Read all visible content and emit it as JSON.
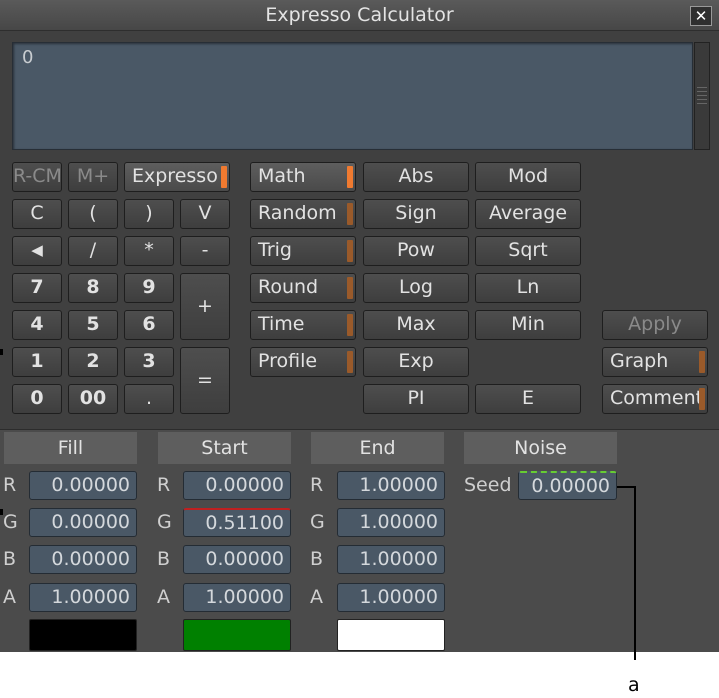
{
  "window": {
    "title": "Expresso Calculator",
    "close_glyph": "✕"
  },
  "display": {
    "value": "0"
  },
  "memory": {
    "rcm": "R-CM",
    "mplus": "M+",
    "expresso": "Expresso"
  },
  "keypad": {
    "c": "C",
    "lparen": "(",
    "rparen": ")",
    "v": "V",
    "back": "◀",
    "div": "/",
    "mul": "*",
    "minus": "-",
    "n7": "7",
    "n8": "8",
    "n9": "9",
    "plus": "+",
    "n4": "4",
    "n5": "5",
    "n6": "6",
    "n1": "1",
    "n2": "2",
    "n3": "3",
    "eq": "=",
    "n0": "0",
    "n00": "00",
    "dot": "."
  },
  "categories": {
    "math": "Math",
    "random": "Random",
    "trig": "Trig",
    "round": "Round",
    "time": "Time",
    "profile": "Profile"
  },
  "functions": {
    "abs": "Abs",
    "mod": "Mod",
    "sign": "Sign",
    "average": "Average",
    "pow": "Pow",
    "sqrt": "Sqrt",
    "log": "Log",
    "ln": "Ln",
    "max": "Max",
    "min": "Min",
    "exp": "Exp",
    "pi": "PI",
    "e": "E"
  },
  "actions": {
    "apply": "Apply",
    "graph": "Graph",
    "comment": "Comment"
  },
  "fill": {
    "header": "Fill",
    "r": "R",
    "g": "G",
    "b": "B",
    "a": "A",
    "r_val": "0.00000",
    "g_val": "0.00000",
    "b_val": "0.00000",
    "a_val": "1.00000",
    "swatch_color": "#000000"
  },
  "start": {
    "header": "Start",
    "r": "R",
    "g": "G",
    "b": "B",
    "a": "A",
    "r_val": "0.00000",
    "g_val": "0.51100",
    "b_val": "0.00000",
    "a_val": "1.00000",
    "swatch_color": "#008000"
  },
  "end": {
    "header": "End",
    "r": "R",
    "g": "G",
    "b": "B",
    "a": "A",
    "r_val": "1.00000",
    "g_val": "1.00000",
    "b_val": "1.00000",
    "a_val": "1.00000",
    "swatch_color": "#ffffff"
  },
  "noise": {
    "header": "Noise",
    "seed_label": "Seed",
    "seed_val": "0.00000"
  },
  "callout": {
    "label": "a"
  }
}
